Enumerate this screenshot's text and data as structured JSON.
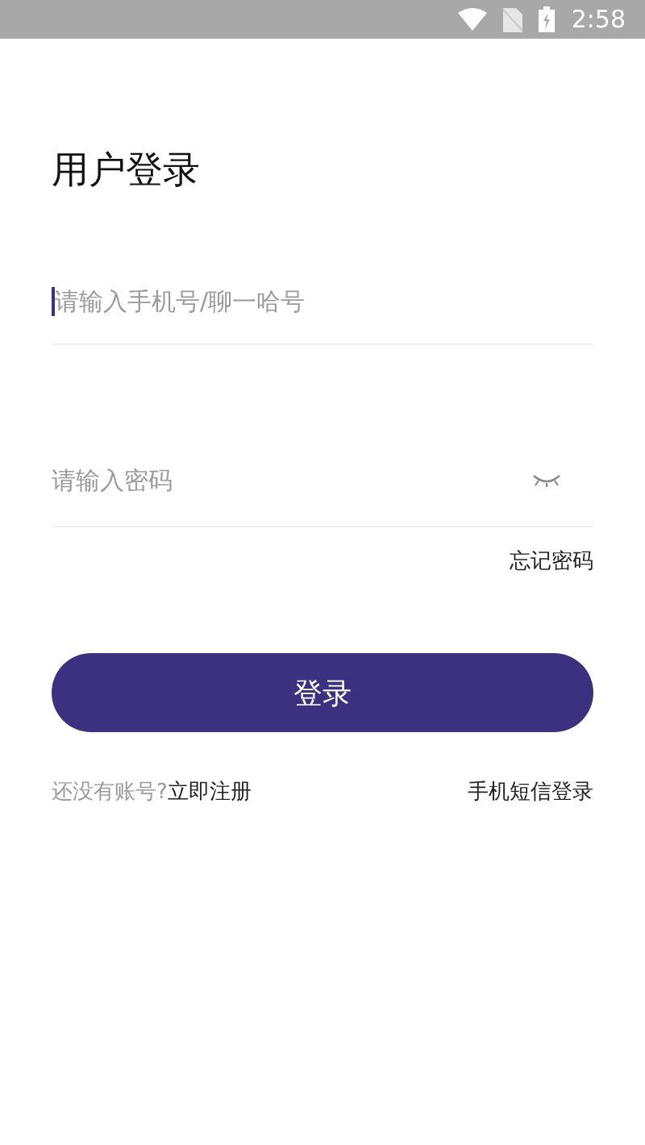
{
  "status_bar": {
    "time": "2:58"
  },
  "title": "用户登录",
  "phone_field": {
    "placeholder": "请输入手机号/聊一哈号",
    "focused": true
  },
  "password_field": {
    "placeholder": "请输入密码",
    "password_visible": false
  },
  "forgot_link": "忘记密码",
  "login_button": "登录",
  "register_prompt": "还没有账号?",
  "register_link": "立即注册",
  "sms_login_link": "手机短信登录"
}
